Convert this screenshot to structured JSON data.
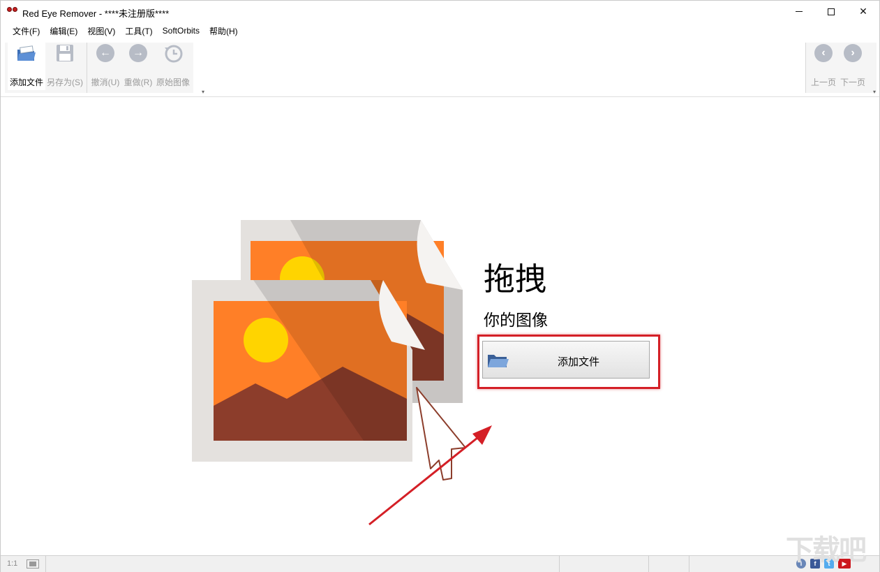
{
  "window": {
    "title": "Red Eye Remover - ****未注册版****"
  },
  "menu": {
    "items": [
      "文件(F)",
      "编辑(E)",
      "视图(V)",
      "工具(T)",
      "SoftOrbits",
      "帮助(H)"
    ]
  },
  "toolbar": {
    "add_files": "添加文件",
    "save_as": "另存为(S)",
    "undo": "撤消(U)",
    "redo": "重做(R)",
    "original": "原始图像",
    "prev_page": "上一页",
    "next_page": "下一页"
  },
  "main": {
    "drag_title": "拖拽",
    "drag_subtitle": "你的图像",
    "add_button": "添加文件"
  },
  "statusbar": {
    "zoom": "1:1"
  },
  "watermark": "下载吧",
  "colors": {
    "highlight": "#d41f26",
    "arrow": "#d41f26",
    "image_orange": "#ff7f27",
    "image_mountain": "#8c3d2b",
    "image_sun": "#ffd400"
  }
}
